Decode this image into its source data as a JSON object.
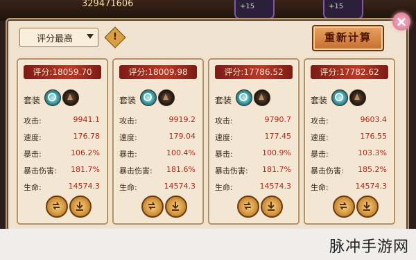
{
  "top": {
    "resource": "329471606",
    "slot1": "+15",
    "slot2": "+15"
  },
  "sort": {
    "selected": "评分最高"
  },
  "warning_icon": "!",
  "recalc_label": "重新计算",
  "close_label": "×",
  "labels": {
    "set": "套装",
    "attack": "攻击:",
    "speed": "速度:",
    "crit": "暴击:",
    "crit_dmg": "暴击伤害:",
    "hp": "生命:"
  },
  "cards": [
    {
      "score": "评分:18059.70",
      "attack": "9941.1",
      "speed": "176.78",
      "crit": "106.2%",
      "crit_dmg": "181.7%",
      "hp": "14574.3"
    },
    {
      "score": "评分:18009.98",
      "attack": "9919.2",
      "speed": "179.04",
      "crit": "100.4%",
      "crit_dmg": "181.6%",
      "hp": "14574.3"
    },
    {
      "score": "评分:17786.52",
      "attack": "9790.7",
      "speed": "177.45",
      "crit": "100.9%",
      "crit_dmg": "181.7%",
      "hp": "14574.3"
    },
    {
      "score": "评分:17782.62",
      "attack": "9603.4",
      "speed": "176.55",
      "crit": "103.3%",
      "crit_dmg": "185.2%",
      "hp": "14574.3"
    }
  ],
  "watermark": "脉冲手游网"
}
